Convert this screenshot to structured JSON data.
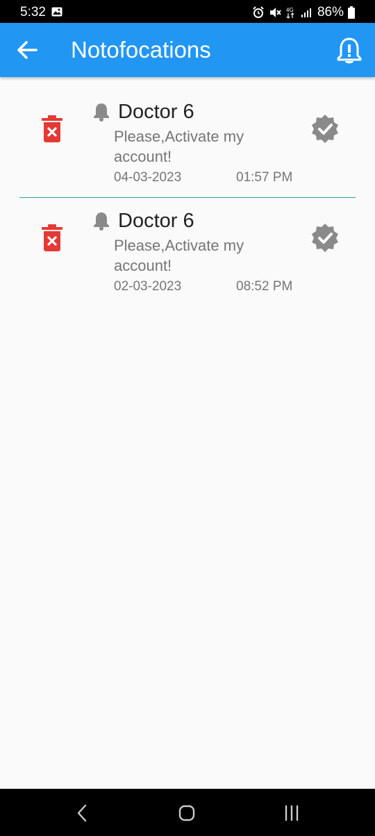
{
  "status_bar": {
    "time": "5:32",
    "battery": "86%",
    "network": "4G"
  },
  "app_bar": {
    "title": "Notofocations",
    "back_icon": "arrow-left-icon",
    "action_icon": "notification-alert-icon"
  },
  "notifications": [
    {
      "sender": "Doctor 6",
      "message": "Please,Activate my account!",
      "date": "04-03-2023",
      "time": "01:57 PM"
    },
    {
      "sender": "Doctor 6",
      "message": "Please,Activate my account!",
      "date": "02-03-2023",
      "time": "08:52 PM"
    }
  ],
  "colors": {
    "primary": "#2196f3",
    "delete": "#e53935",
    "divider": "#26a69a",
    "icon_gray": "#8a8a8a"
  }
}
